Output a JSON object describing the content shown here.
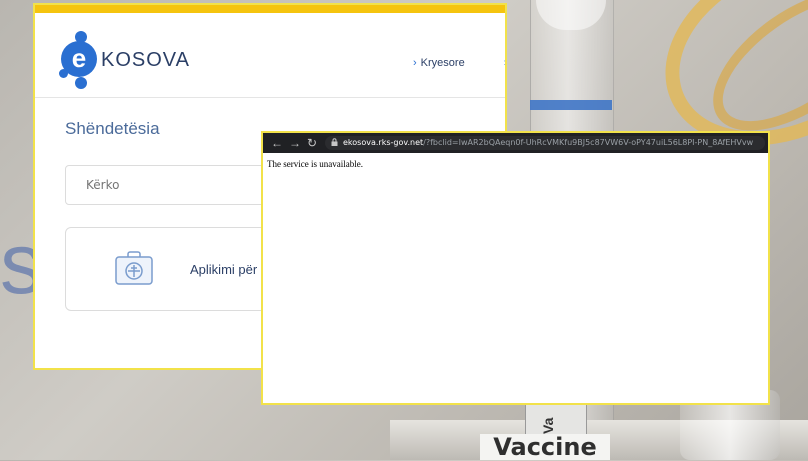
{
  "background": {
    "side_text": "st",
    "vial_label": "Va",
    "bottom_label": "Vaccine"
  },
  "ekosova": {
    "logo_letter": "e",
    "logo_text": "KOSOVA",
    "nav": [
      "Kryesore",
      "Sh"
    ],
    "section_title": "Shëndetësia",
    "search_placeholder": "Kërko",
    "app_label": "Aplikimi për",
    "icon": "first-aid-kit-icon"
  },
  "browser": {
    "url_host": "ekosova.rks-gov.net",
    "url_path": "/?fbclid=IwAR2bQAeqn0f-UhRcVMKfu9BJ5c87VW6V-oPY47uiL56L8PI-PN_8AfEHVvw",
    "message": "The service is unavailable."
  },
  "colors": {
    "accent_yellow": "#f2e24a",
    "brand_blue": "#2a6fd1",
    "chrome_dark": "#202124"
  }
}
